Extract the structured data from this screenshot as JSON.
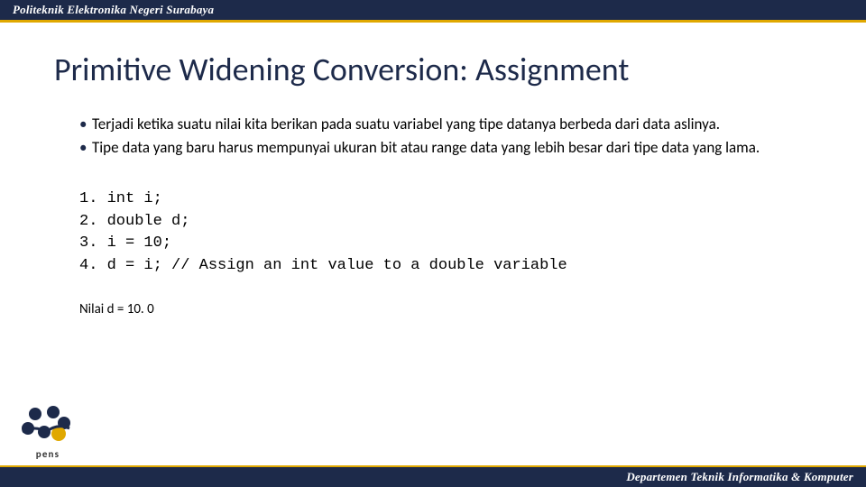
{
  "header": {
    "institution": "Politeknik Elektronika Negeri Surabaya"
  },
  "title": "Primitive Widening Conversion: Assignment",
  "bullets": [
    "Terjadi ketika suatu nilai kita berikan pada suatu variabel yang tipe datanya berbeda dari data aslinya.",
    "Tipe data yang baru harus mempunyai ukuran bit atau range data yang lebih besar dari tipe data yang lama."
  ],
  "code": {
    "lines": [
      "1. int i;",
      "2. double d;",
      "3. i = 10;",
      "4. d = i; // Assign an int value to a double variable"
    ]
  },
  "result_text": "Nilai d = 10. 0",
  "footer": {
    "department": "Departemen Teknik Informatika & Komputer"
  },
  "logo": {
    "label": "pens"
  }
}
